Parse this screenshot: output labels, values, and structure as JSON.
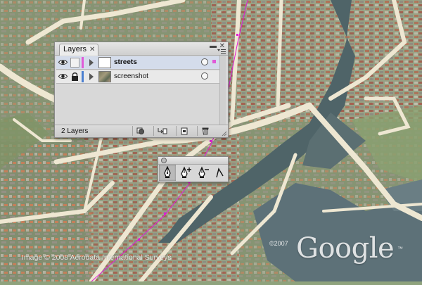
{
  "map": {
    "attribution": "Image © 2008 Aerodata International Surveys",
    "copyright_year": "©2007",
    "brand": "Google",
    "trademark": "™",
    "path_color": "#e01ad8"
  },
  "layers_panel": {
    "tab_label": "Layers",
    "tab_close": "✕",
    "layers": [
      {
        "name": "streets",
        "color": "#e05ad8",
        "visible": true,
        "locked": false,
        "selected": true
      },
      {
        "name": "screenshot",
        "color": "#4a7fd0",
        "visible": true,
        "locked": true,
        "selected": false
      }
    ],
    "layer_count": "2 Layers",
    "footer_buttons": [
      "make-clipping-mask",
      "create-sublayer",
      "create-new-layer",
      "delete-layer"
    ]
  },
  "pen_tools": {
    "tools": [
      "pen-tool",
      "add-anchor-point-tool",
      "delete-anchor-point-tool",
      "convert-anchor-point-tool"
    ],
    "active": "pen-tool"
  }
}
